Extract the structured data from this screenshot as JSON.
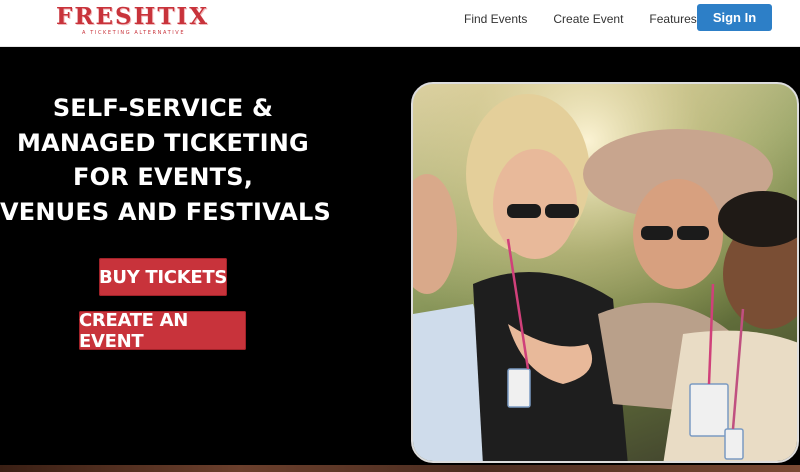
{
  "header": {
    "logo_text": "FRESHTIX",
    "logo_tagline": "A TICKETING ALTERNATIVE",
    "nav": [
      "Find Events",
      "Create Event",
      "Features"
    ],
    "signin_label": "Sign In"
  },
  "hero": {
    "title_lines": [
      "SELF-SERVICE &",
      "MANAGED TICKETING",
      "FOR EVENTS,",
      "VENUES AND FESTIVALS"
    ],
    "buy_label": "BUY TICKETS",
    "create_label": "CREATE AN EVENT"
  },
  "colors": {
    "brand_red": "#c8333b",
    "signin_blue": "#2d7fc7",
    "hero_bg": "#000000"
  }
}
